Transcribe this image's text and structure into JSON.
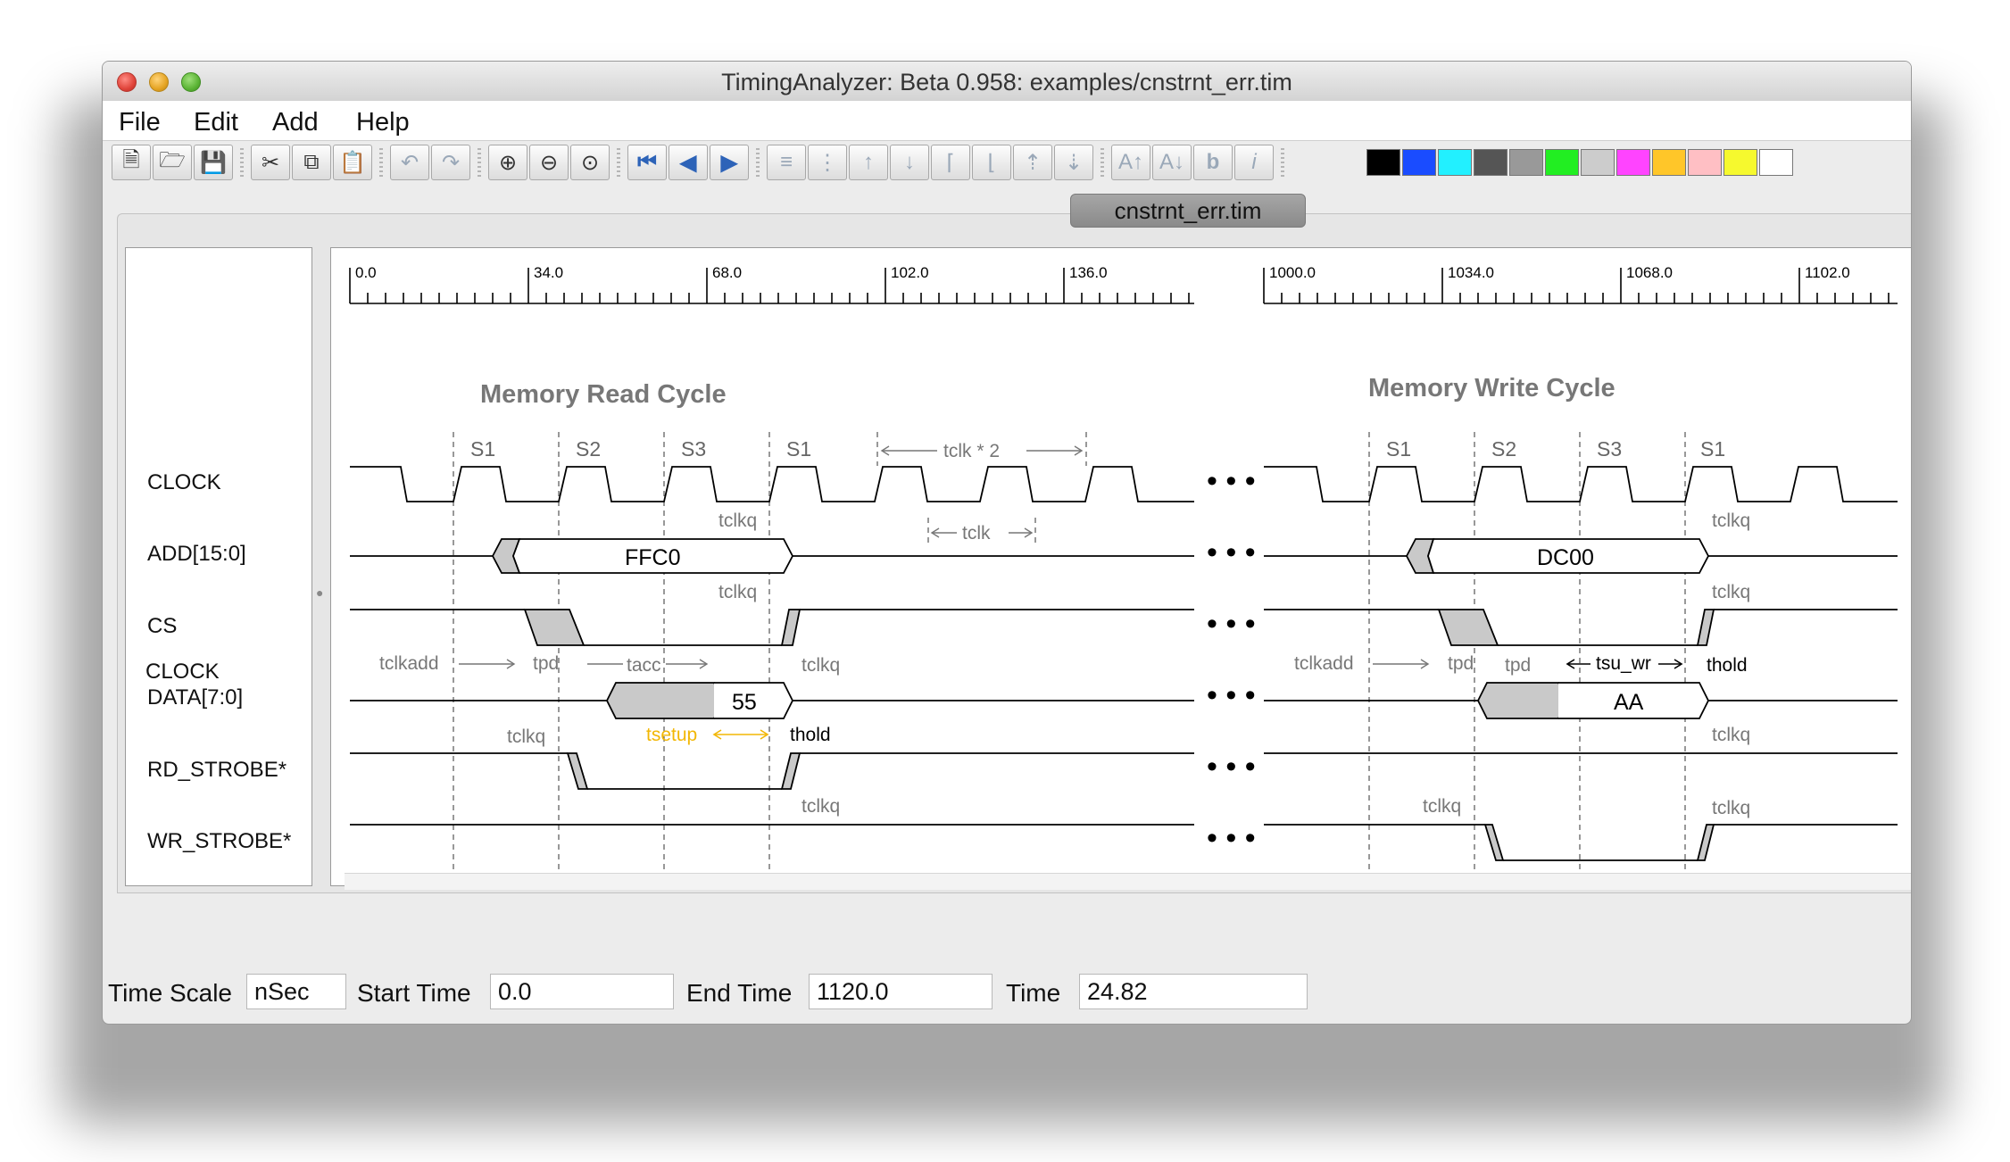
{
  "window": {
    "title": "TimingAnalyzer: Beta 0.958:   examples/cnstrnt_err.tim"
  },
  "menubar": {
    "items": [
      "File",
      "Edit",
      "Add",
      "Help"
    ]
  },
  "toolbar": {
    "buttons": [
      "new-file",
      "open-folder",
      "save",
      "cut",
      "copy",
      "paste",
      "undo",
      "redo",
      "zoom-in",
      "zoom-out",
      "zoom-fit",
      "go-start",
      "step-back",
      "step-forward",
      "align-lines",
      "dotted-lines",
      "arrow-up",
      "arrow-down",
      "rising-edge",
      "falling-edge",
      "move-up",
      "move-down",
      "font-bigger",
      "font-smaller",
      "bold",
      "italic"
    ],
    "palette": [
      "#000000",
      "#1a4cff",
      "#22f0ff",
      "#555555",
      "#999999",
      "#22ee22",
      "#cccccc",
      "#ff44ff",
      "#ffc629",
      "#ffbfc4",
      "#f6f92e",
      "#ffffff"
    ]
  },
  "tab": {
    "label": "cnstrnt_err.tim"
  },
  "signals": [
    "CLOCK",
    "ADD[15:0]",
    "CS",
    "DATA[7:0]",
    "RD_STROBE*",
    "WR_STROBE*"
  ],
  "ruler": {
    "left_ticks": [
      "0.0",
      "34.0",
      "68.0",
      "102.0",
      "136.0"
    ],
    "right_ticks": [
      "1000.0",
      "1034.0",
      "1068.0",
      "1102.0"
    ]
  },
  "diagram": {
    "read_title": "Memory Read Cycle",
    "write_title": "Memory Write Cycle",
    "states_read": [
      "S1",
      "S2",
      "S3",
      "S1"
    ],
    "states_write": [
      "S1",
      "S2",
      "S3",
      "S1"
    ],
    "tclk2": "tclk * 2",
    "tclk": "tclk",
    "add_read": "FFC0",
    "add_write": "DC00",
    "data_read": "55",
    "data_write": "AA",
    "tclkq": "tclkq",
    "tclkadd": "tclkadd",
    "tpd": "tpd",
    "tacc": "tacc",
    "tsetup": "tsetup",
    "thold": "thold",
    "tsu_wr": "tsu_wr",
    "ellipsis": "• • •"
  },
  "colors": {
    "setup_warning": "#f2b705",
    "bus_fill": "#c9c9c9",
    "annotation": "#808080"
  },
  "status": {
    "time_scale_label": "Time Scale",
    "time_scale": "nSec",
    "start_label": "Start Time",
    "start": "0.0",
    "end_label": "End Time",
    "end": "1120.0",
    "time_label": "Time",
    "time": "24.82"
  }
}
